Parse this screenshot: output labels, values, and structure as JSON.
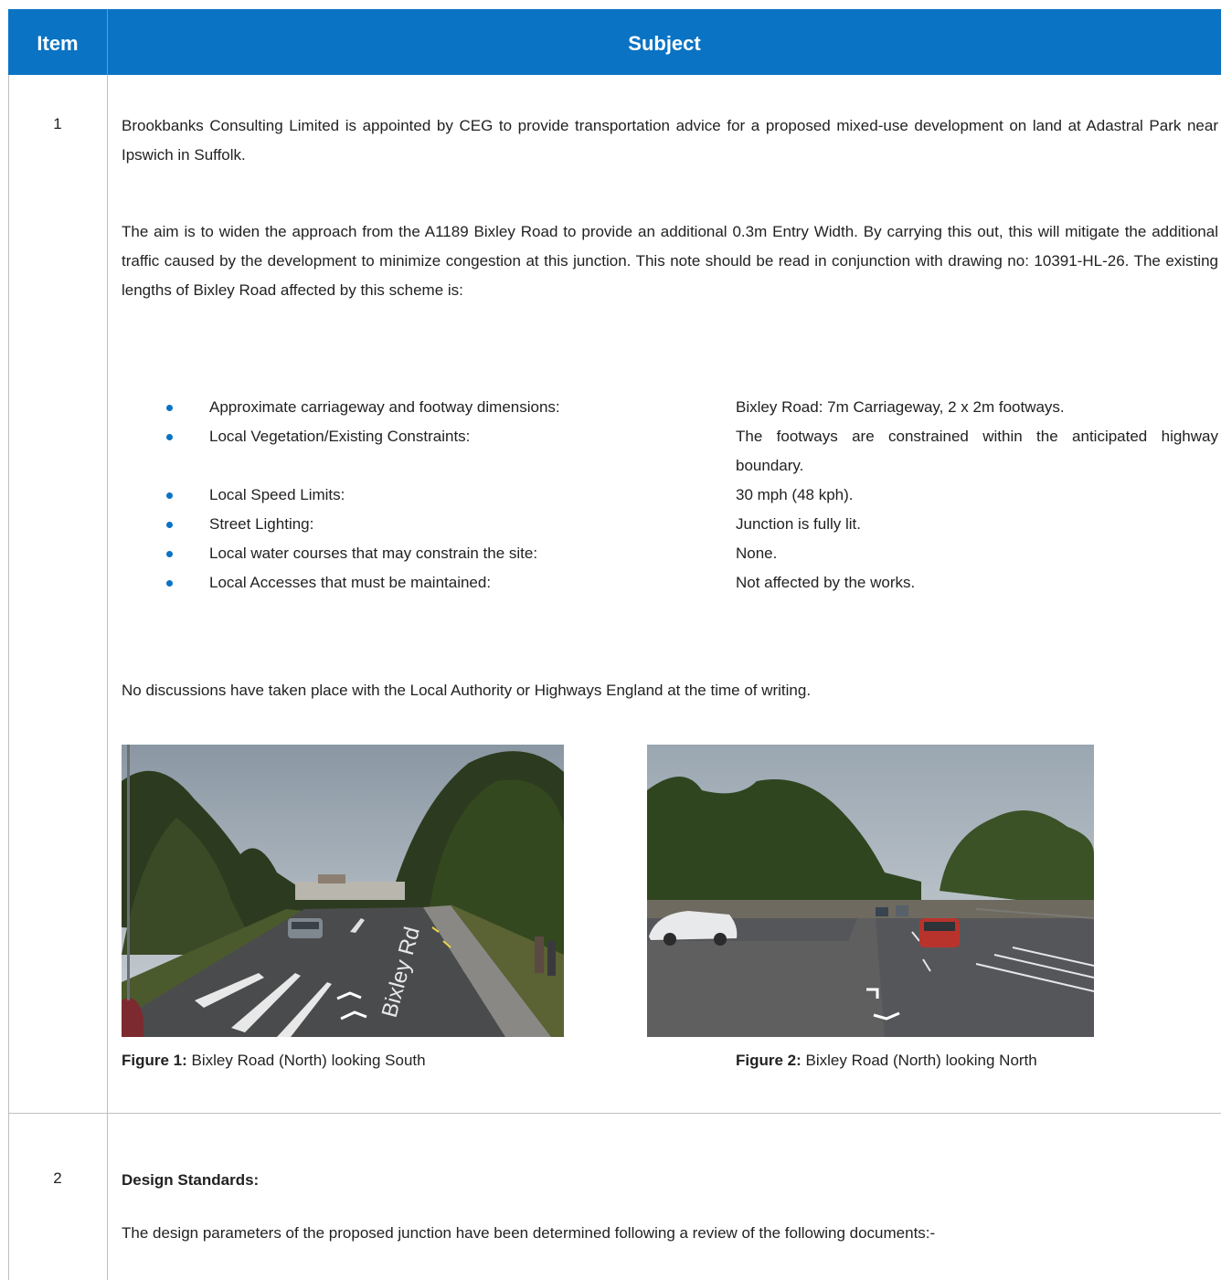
{
  "table": {
    "header": {
      "item_label": "Item",
      "subject_label": "Subject"
    },
    "row1": {
      "number": "1",
      "para1": "Brookbanks Consulting Limited is appointed by CEG to provide transportation advice for a proposed mixed-use development on land at Adastral Park near Ipswich in Suffolk.",
      "para2": "The aim is to widen the approach from the A1189 Bixley Road to provide an additional 0.3m Entry Width. By carrying this out, this will mitigate the additional traffic caused by the development to minimize congestion at this junction.  This note should be read in conjunction with drawing no: 10391-HL-26.  The existing lengths of Bixley Road affected by this scheme is:",
      "bullets": [
        {
          "label": "Approximate carriageway and footway dimensions:",
          "value": "Bixley Road: 7m Carriageway, 2 x 2m footways."
        },
        {
          "label": "Local Vegetation/Existing Constraints:",
          "value": "The footways are constrained within the anticipated highway boundary."
        },
        {
          "label": "Local Speed Limits:",
          "value": "30 mph (48 kph)."
        },
        {
          "label": "Street Lighting:",
          "value": "Junction is fully lit."
        },
        {
          "label": "Local water courses that may constrain the site:",
          "value": "None."
        },
        {
          "label": "Local Accesses that must be maintained:",
          "value": "Not affected by the works."
        }
      ],
      "para3": "No discussions have taken place with the Local Authority or Highways England at the time of writing.",
      "figure1": {
        "label": "Figure 1:",
        "caption": " Bixley Road (North) looking South",
        "road_marking_text": "Bixley Rd"
      },
      "figure2": {
        "label": "Figure 2:",
        "caption": " Bixley Road (North) looking North"
      }
    },
    "row2": {
      "number": "2",
      "heading": "Design Standards:",
      "para1": "The design parameters of the proposed junction have been determined following a review of the following documents:-"
    }
  },
  "colors": {
    "header_bg": "#0a73c4",
    "bullet": "#0a73c4",
    "grid": "#bfbfbf"
  }
}
